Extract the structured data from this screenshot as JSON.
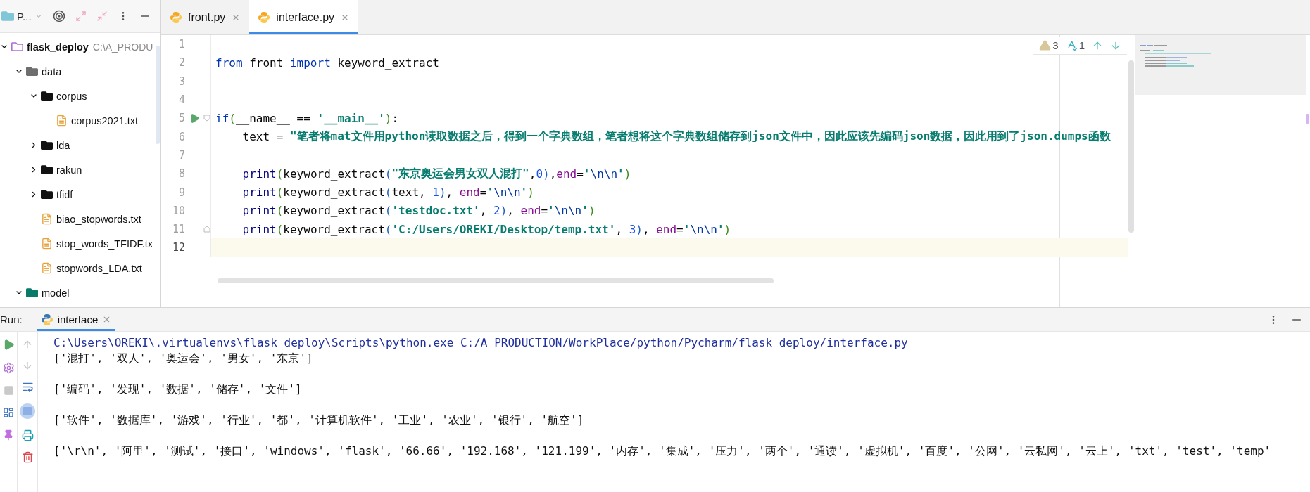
{
  "project_panel": {
    "title": "P...",
    "tree": [
      {
        "label": "flask_deploy",
        "path": "C:\\A_PRODU",
        "kind": "project",
        "expanded": true,
        "children": [
          {
            "label": "data",
            "kind": "data-folder",
            "expanded": true,
            "children": [
              {
                "label": "corpus",
                "kind": "folder",
                "expanded": true,
                "children": [
                  {
                    "label": "corpus2021.txt",
                    "kind": "file"
                  }
                ]
              },
              {
                "label": "lda",
                "kind": "folder",
                "expanded": false
              },
              {
                "label": "rakun",
                "kind": "folder",
                "expanded": false
              },
              {
                "label": "tfidf",
                "kind": "folder",
                "expanded": false
              },
              {
                "label": "biao_stopwords.txt",
                "kind": "file"
              },
              {
                "label": "stop_words_TFIDF.tx",
                "kind": "file"
              },
              {
                "label": "stopwords_LDA.txt",
                "kind": "file"
              }
            ]
          },
          {
            "label": "model",
            "kind": "model-folder",
            "expanded": true
          }
        ]
      }
    ]
  },
  "editor": {
    "tabs": [
      {
        "label": "front.py",
        "selected": false
      },
      {
        "label": "interface.py",
        "selected": true
      }
    ],
    "inspections": {
      "warnings": "3",
      "typos": "1"
    },
    "lines": [
      {
        "number": "1",
        "current": false,
        "run": false,
        "fold": false
      },
      {
        "number": "2",
        "current": false,
        "run": false,
        "fold": false,
        "tokens": [
          {
            "kind": "kw",
            "text": "from"
          },
          {
            "kind": "plain",
            "text": " front "
          },
          {
            "kind": "kw",
            "text": "import"
          },
          {
            "kind": "plain",
            "text": " keyword_extract"
          }
        ]
      },
      {
        "number": "3",
        "current": false,
        "run": false,
        "fold": false
      },
      {
        "number": "4",
        "current": false,
        "run": false,
        "fold": false
      },
      {
        "number": "5",
        "current": false,
        "run": true,
        "fold": true,
        "tokens": [
          {
            "kind": "kw",
            "text": "if"
          },
          {
            "kind": "paren1",
            "text": "("
          },
          {
            "kind": "plain",
            "text": "__name__ == "
          },
          {
            "kind": "str",
            "text": "'__main__'"
          },
          {
            "kind": "paren1",
            "text": ")"
          },
          {
            "kind": "plain",
            "text": ":"
          }
        ]
      },
      {
        "number": "6",
        "current": false,
        "run": false,
        "fold": false,
        "tokens": [
          {
            "kind": "plain",
            "text": "    text = "
          },
          {
            "kind": "str",
            "text": "\"笔者将mat文件用python读取数据之后，得到一个字典数组，笔者想将这个字典数组储存到json文件中，因此应该先编码json数据，因此用到了json.dumps函数"
          }
        ]
      },
      {
        "number": "7",
        "current": false,
        "run": false,
        "fold": false
      },
      {
        "number": "8",
        "current": false,
        "run": false,
        "fold": false,
        "tokens": [
          {
            "kind": "builtin",
            "text": "    print"
          },
          {
            "kind": "paren1",
            "text": "("
          },
          {
            "kind": "plain",
            "text": "keyword_extract"
          },
          {
            "kind": "paren2",
            "text": "("
          },
          {
            "kind": "str",
            "text": "\"东京奥运会男女双人混打\""
          },
          {
            "kind": "plain",
            "text": ","
          },
          {
            "kind": "num",
            "text": "0"
          },
          {
            "kind": "paren2",
            "text": ")"
          },
          {
            "kind": "plain",
            "text": ","
          },
          {
            "kind": "param",
            "text": "end"
          },
          {
            "kind": "plain",
            "text": "="
          },
          {
            "kind": "str",
            "text": "'"
          },
          {
            "kind": "escape",
            "text": "\\n\\n"
          },
          {
            "kind": "str",
            "text": "'"
          },
          {
            "kind": "paren1",
            "text": ")"
          }
        ]
      },
      {
        "number": "9",
        "current": false,
        "run": false,
        "fold": false,
        "tokens": [
          {
            "kind": "builtin",
            "text": "    print"
          },
          {
            "kind": "paren1",
            "text": "("
          },
          {
            "kind": "plain",
            "text": "keyword_extract"
          },
          {
            "kind": "paren2",
            "text": "("
          },
          {
            "kind": "plain",
            "text": "text, "
          },
          {
            "kind": "num",
            "text": "1"
          },
          {
            "kind": "paren2",
            "text": ")"
          },
          {
            "kind": "plain",
            "text": ", "
          },
          {
            "kind": "param",
            "text": "end"
          },
          {
            "kind": "plain",
            "text": "="
          },
          {
            "kind": "str",
            "text": "'"
          },
          {
            "kind": "escape",
            "text": "\\n\\n"
          },
          {
            "kind": "str",
            "text": "'"
          },
          {
            "kind": "paren1",
            "text": ")"
          }
        ]
      },
      {
        "number": "10",
        "current": false,
        "run": false,
        "fold": false,
        "tokens": [
          {
            "kind": "builtin",
            "text": "    print"
          },
          {
            "kind": "paren1",
            "text": "("
          },
          {
            "kind": "plain",
            "text": "keyword_extract"
          },
          {
            "kind": "paren2",
            "text": "("
          },
          {
            "kind": "str",
            "text": "'testdoc.txt'"
          },
          {
            "kind": "plain",
            "text": ", "
          },
          {
            "kind": "num",
            "text": "2"
          },
          {
            "kind": "paren2",
            "text": ")"
          },
          {
            "kind": "plain",
            "text": ", "
          },
          {
            "kind": "param",
            "text": "end"
          },
          {
            "kind": "plain",
            "text": "="
          },
          {
            "kind": "str",
            "text": "'"
          },
          {
            "kind": "escape",
            "text": "\\n\\n"
          },
          {
            "kind": "str",
            "text": "'"
          },
          {
            "kind": "paren1",
            "text": ")"
          }
        ]
      },
      {
        "number": "11",
        "current": false,
        "run": false,
        "fold": true,
        "tokens": [
          {
            "kind": "builtin",
            "text": "    print"
          },
          {
            "kind": "paren1",
            "text": "("
          },
          {
            "kind": "plain",
            "text": "keyword_extract"
          },
          {
            "kind": "paren2",
            "text": "("
          },
          {
            "kind": "str",
            "text": "'C:/Users/OREKI/Desktop/temp.txt'"
          },
          {
            "kind": "plain",
            "text": ", "
          },
          {
            "kind": "num",
            "text": "3"
          },
          {
            "kind": "paren2",
            "text": ")"
          },
          {
            "kind": "plain",
            "text": ", "
          },
          {
            "kind": "param",
            "text": "end"
          },
          {
            "kind": "plain",
            "text": "="
          },
          {
            "kind": "str",
            "text": "'"
          },
          {
            "kind": "escape",
            "text": "\\n\\n"
          },
          {
            "kind": "str",
            "text": "'"
          },
          {
            "kind": "paren1",
            "text": ")"
          }
        ]
      },
      {
        "number": "12",
        "current": true,
        "run": false,
        "fold": false
      }
    ]
  },
  "run_panel": {
    "label": "Run:",
    "tabs": [
      {
        "label": "interface",
        "selected": true
      }
    ],
    "console": [
      {
        "kind": "command",
        "text": "C:\\Users\\OREKI\\.virtualenvs\\flask_deploy\\Scripts\\python.exe C:/A_PRODUCTION/WorkPlace/python/Pycharm/flask_deploy/interface.py"
      },
      {
        "kind": "output",
        "text": "['混打', '双人', '奥运会', '男女', '东京']"
      },
      {
        "kind": "output",
        "text": "['编码', '发现', '数据', '储存', '文件']"
      },
      {
        "kind": "output",
        "text": "['软件', '数据库', '游戏', '行业', '都', '计算机软件', '工业', '农业', '银行', '航空']"
      },
      {
        "kind": "output",
        "text": "['\\r\\n', '阿里', '测试', '接口', 'windows', 'flask', '66.66', '192.168', '121.199', '内存', '集成', '压力', '两个', '通读', '虚拟机', '百度', '公网', '云私网', '云上', 'txt', 'test', 'temp'"
      }
    ]
  }
}
